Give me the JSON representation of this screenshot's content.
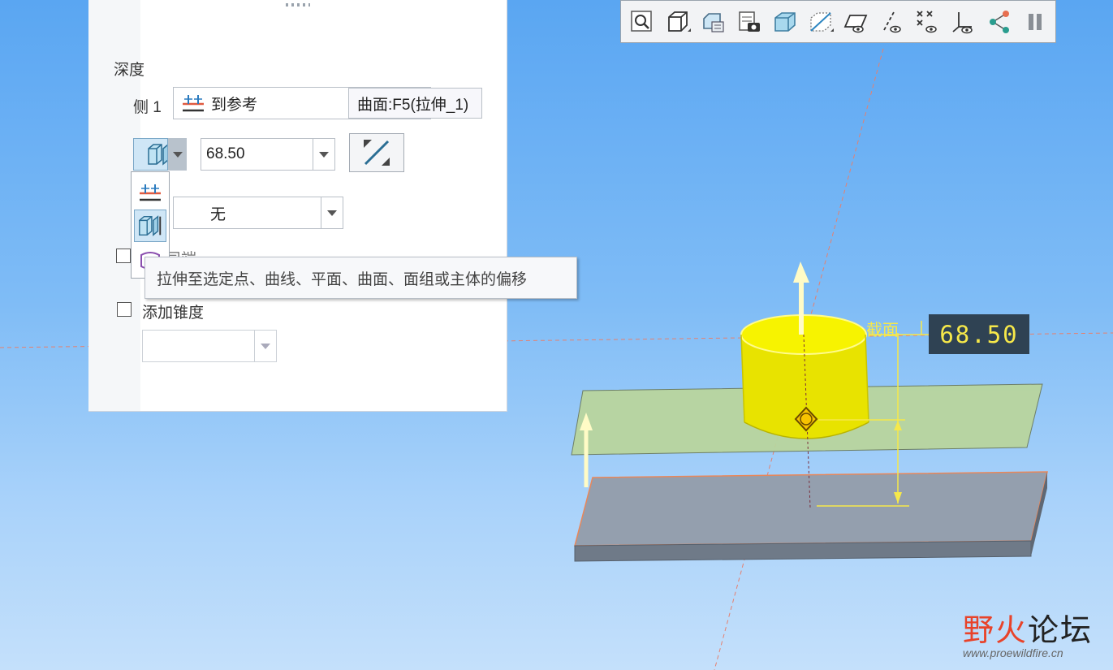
{
  "panel": {
    "section_title": "深度",
    "side1_label": "侧 1",
    "side1_type": "到参考",
    "reference_value": "曲面:F5(拉伸_1)",
    "offset_value": "68.50",
    "side2_value": "无",
    "trim_label_partial": "司端",
    "add_draft_label": "添加锥度",
    "draft_value": ""
  },
  "tooltip": {
    "text": "拉伸至选定点、曲线、平面、曲面、面组或主体的偏移"
  },
  "viewport": {
    "section_label": "截面",
    "dimension_value": "68.50"
  },
  "toolbar": {
    "icons": [
      "zoom-icon",
      "display-style-icon",
      "saved-views-icon",
      "view-manager-icon",
      "perspective-icon",
      "section-icon",
      "plane-display-icon",
      "axis-display-icon",
      "point-display-icon",
      "csys-display-icon",
      "annotation-display-icon",
      "pause-icon"
    ]
  },
  "watermark": {
    "brand_part1": "野火",
    "brand_part2": "论坛",
    "url": "www.proewildfire.cn"
  },
  "colors": {
    "extrude": "#f2ef12",
    "plane": "#bcd8a0",
    "base": "#8e9aa8",
    "dimension_text": "#f6e84a"
  }
}
